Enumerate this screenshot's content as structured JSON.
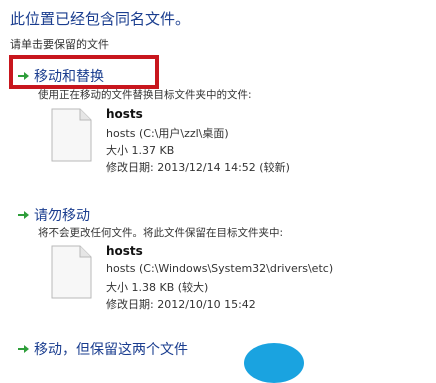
{
  "dialog": {
    "title": "此位置已经包含同名文件。",
    "subtitle": "请单击要保留的文件"
  },
  "options": [
    {
      "label": "移动和替换",
      "description": "使用正在移动的文件替换目标文件夹中的文件:",
      "file": {
        "name": "hosts",
        "path": "hosts (C:\\用户\\zzl\\桌面)",
        "size": "大小 1.37 KB",
        "modified": "修改日期: 2013/12/14 14:52 (较新)"
      }
    },
    {
      "label": "请勿移动",
      "description": "将不会更改任何文件。将此文件保留在目标文件夹中:",
      "file": {
        "name": "hosts",
        "path": "hosts (C:\\Windows\\System32\\drivers\\etc)",
        "size": "大小 1.38 KB (较大)",
        "modified": "修改日期: 2012/10/10 15:42"
      }
    },
    {
      "label": "移动，但保留这两个文件"
    }
  ],
  "colors": {
    "accent": "#1a3d8f",
    "arrow": "#2e9e3a",
    "highlight": "#c8161d",
    "bubble": "#1aa3e0"
  },
  "icons": {
    "option_arrow": "green-right-arrow-icon",
    "file": "generic-file-icon"
  }
}
